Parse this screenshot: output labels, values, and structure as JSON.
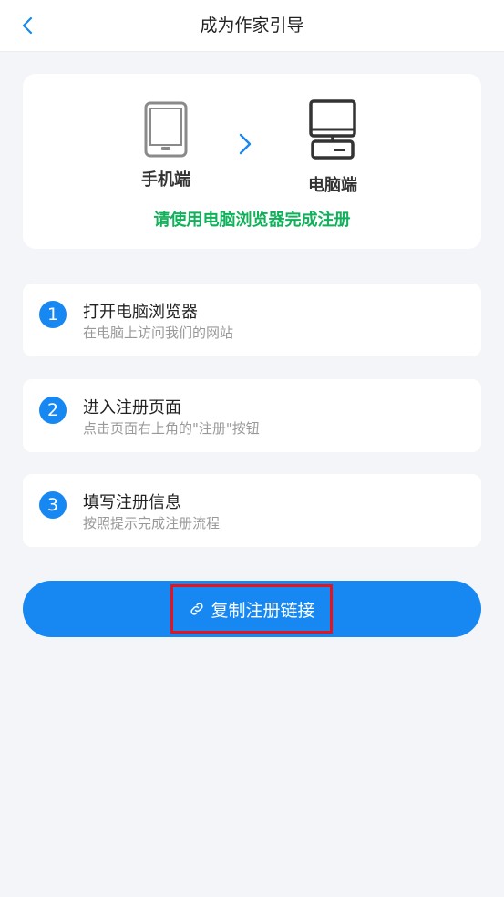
{
  "header": {
    "title": "成为作家引导",
    "back_icon": "chevron-left-icon"
  },
  "devices": {
    "mobile_label": "手机端",
    "pc_label": "电脑端",
    "instruction": "请使用电脑浏览器完成注册",
    "instruction_color": "#10b15a"
  },
  "steps": [
    {
      "num": "1",
      "title": "打开电脑浏览器",
      "desc": "在电脑上访问我们的网站"
    },
    {
      "num": "2",
      "title": "进入注册页面",
      "desc": "点击页面右上角的\"注册\"按钮"
    },
    {
      "num": "3",
      "title": "填写注册信息",
      "desc": "按照提示完成注册流程"
    }
  ],
  "copy_button": {
    "label": "复制注册链接",
    "icon": "link-icon"
  },
  "colors": {
    "accent": "#1787f2",
    "highlight": "#e8121b",
    "background": "#f4f5f8"
  }
}
